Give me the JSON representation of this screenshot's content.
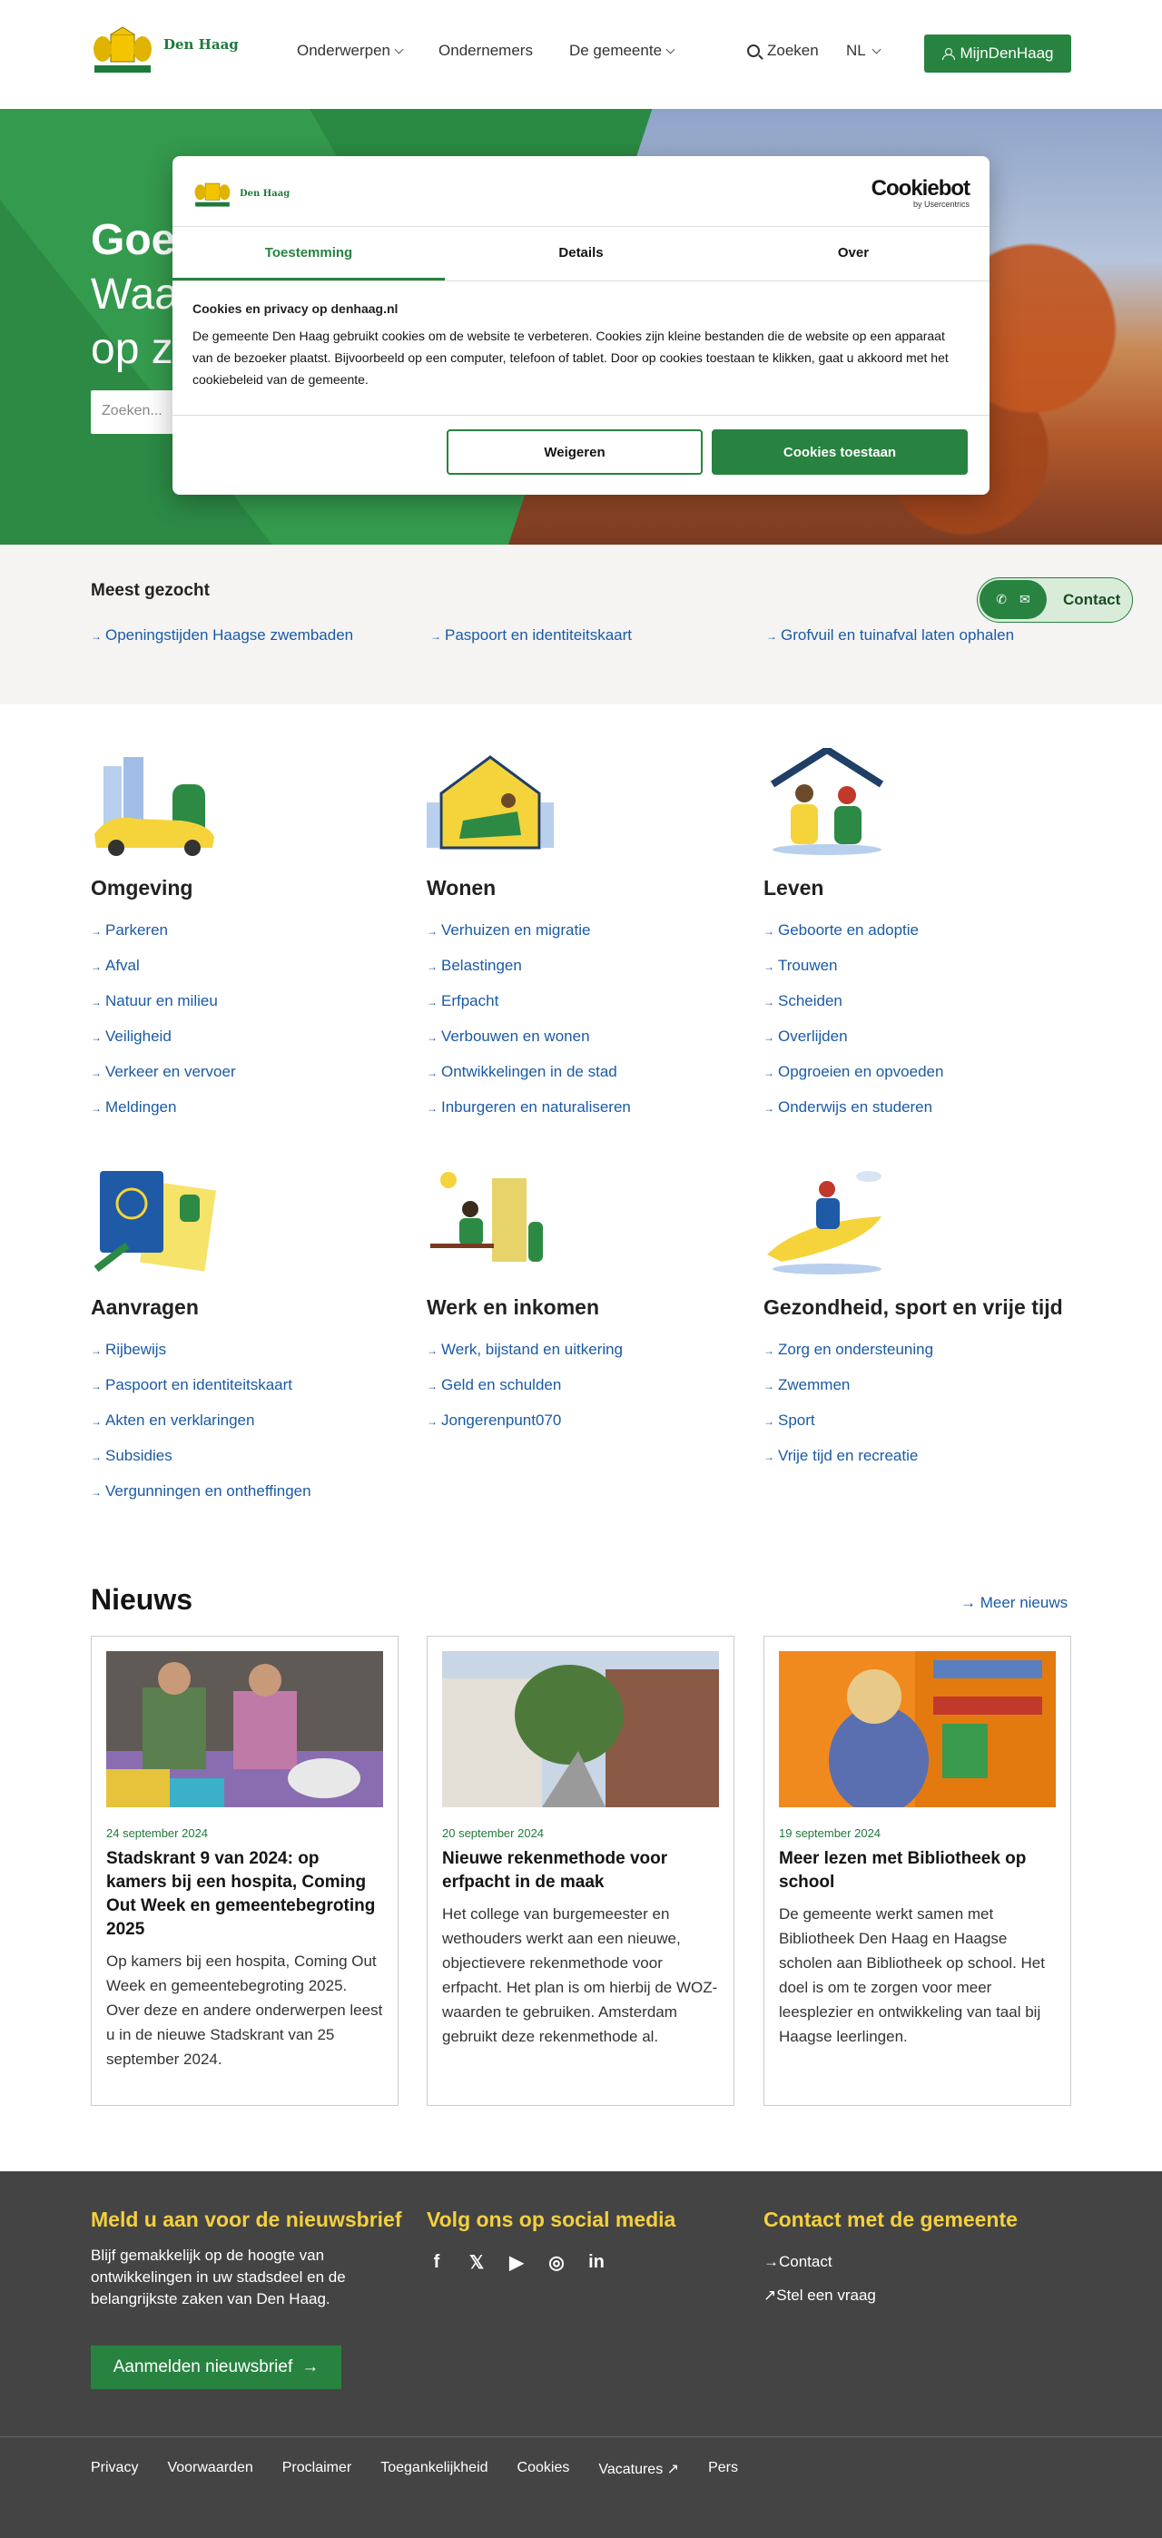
{
  "brand": {
    "name": "Den Haag"
  },
  "header": {
    "nav": [
      {
        "label": "Onderwerpen",
        "dropdown": true
      },
      {
        "label": "Ondernemers",
        "dropdown": false
      },
      {
        "label": "De gemeente",
        "dropdown": true
      }
    ],
    "search_label": "Zoeken",
    "lang": "NL",
    "account_button": "MijnDenHaag"
  },
  "hero": {
    "title_line1": "Goed",
    "title_line2": "Waa",
    "title_line3": "op ze",
    "search_placeholder": "Zoeken..."
  },
  "cookie_modal": {
    "brand_name": "Den Haag",
    "provider": "Cookiebot",
    "provider_sub": "by Usercentrics",
    "tabs": [
      "Toestemming",
      "Details",
      "Over"
    ],
    "active_tab": "Toestemming",
    "heading": "Cookies en privacy op denhaag.nl",
    "body": "De gemeente Den Haag gebruikt cookies om de website te verbeteren. Cookies zijn kleine bestanden die de website op een apparaat van de bezoeker plaatst. Bijvoorbeeld op een computer, telefoon of tablet. Door op cookies toestaan te klikken, gaat u akkoord met het cookiebeleid van de gemeente.",
    "decline": "Weigeren",
    "accept": "Cookies toestaan"
  },
  "most_searched": {
    "title": "Meest gezocht",
    "links": [
      "Openingstijden Haagse zwembaden",
      "Paspoort en identiteitskaart",
      "Grofvuil en tuinafval laten ophalen"
    ]
  },
  "contact_button": "Contact",
  "categories": [
    {
      "title": "Omgeving",
      "links": [
        "Parkeren",
        "Afval",
        "Natuur en milieu",
        "Veiligheid",
        "Verkeer en vervoer",
        "Meldingen"
      ]
    },
    {
      "title": "Wonen",
      "links": [
        "Verhuizen en migratie",
        "Belastingen",
        "Erfpacht",
        "Verbouwen en wonen",
        "Ontwikkelingen in de stad",
        "Inburgeren en naturaliseren"
      ]
    },
    {
      "title": "Leven",
      "links": [
        "Geboorte en adoptie",
        "Trouwen",
        "Scheiden",
        "Overlijden",
        "Opgroeien en opvoeden",
        "Onderwijs en studeren"
      ]
    },
    {
      "title": "Aanvragen",
      "links": [
        "Rijbewijs",
        "Paspoort en identiteitskaart",
        "Akten en verklaringen",
        "Subsidies",
        "Vergunningen en ontheffingen"
      ]
    },
    {
      "title": "Werk en inkomen",
      "links": [
        "Werk, bijstand en uitkering",
        "Geld en schulden",
        "Jongerenpunt070"
      ]
    },
    {
      "title": "Gezondheid, sport en vrije tijd",
      "links": [
        "Zorg en ondersteuning",
        "Zwemmen",
        "Sport",
        "Vrije tijd en recreatie"
      ]
    }
  ],
  "news": {
    "title": "Nieuws",
    "more": "Meer nieuws",
    "items": [
      {
        "date": "24 september 2024",
        "title": "Stadskrant 9 van 2024: op kamers bij een hospita, Coming Out Week en gemeentebegroting 2025",
        "text": "Op kamers bij een hospita, Coming Out Week en gemeentebegroting 2025. Over deze en andere onderwerpen leest u in de nieuwe Stadskrant van 25 september 2024."
      },
      {
        "date": "20 september 2024",
        "title": "Nieuwe rekenmethode voor erfpacht in de maak",
        "text": "Het college van burgemeester en wethouders werkt aan een nieuwe, objectievere rekenmethode voor erfpacht. Het plan is om hierbij de WOZ-waarden te gebruiken. Amsterdam gebruikt deze rekenmethode al."
      },
      {
        "date": "19 september 2024",
        "title": "Meer lezen met Bibliotheek op school",
        "text": "De gemeente werkt samen met Bibliotheek Den Haag en Haagse scholen aan Bibliotheek op school. Het doel is om te zorgen voor meer leesplezier en ontwikkeling van taal bij Haagse leerlingen."
      }
    ]
  },
  "footer": {
    "newsletter_title": "Meld u aan voor de nieuwsbrief",
    "newsletter_text": "Blijf gemakkelijk op de hoogte van ontwikkelingen in uw stadsdeel en de belangrijkste zaken van Den Haag.",
    "newsletter_button": "Aanmelden nieuwsbrief",
    "social_title": "Volg ons op social media",
    "contact_title": "Contact met de gemeente",
    "contact_links": [
      "Contact",
      "Stel een vraag"
    ],
    "bottom_links": [
      "Privacy",
      "Voorwaarden",
      "Proclaimer",
      "Toegankelijkheid",
      "Cookies",
      "Vacatures",
      "Pers"
    ]
  },
  "colors": {
    "brand_green": "#27833f",
    "link_blue": "#1a5aa6",
    "footer_bg": "#444444",
    "footer_heading": "#f4d03f"
  }
}
